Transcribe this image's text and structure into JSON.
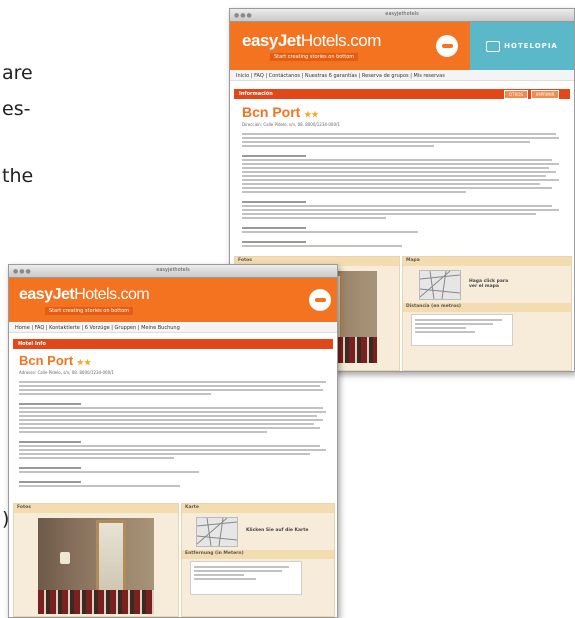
{
  "background_text": {
    "line1": "are",
    "line2": "es-",
    "line3": "the",
    "line4": ")"
  },
  "win_es": {
    "titlebar": "easyjethotels",
    "logo_bold": "easyJet",
    "logo_thin": "Hotels.com",
    "tagline": "Start creating stories on bottom",
    "partner": "HOTELOPIA",
    "nav": "Inicio | FAQ | Contáctanos | Nuestras 6 garantías | Reserva de grupos | Mis reservas",
    "section": "Información",
    "btn1": "OTROS",
    "btn2": "IMPRIMIR",
    "hotel_name": "Bcn Port",
    "stars": "★★",
    "address": "Dirección: Calle Pidelo, s/n, 08. 8000/1234-000/1",
    "photos_label": "Fotos",
    "map_label": "Mapa",
    "map_caption": "Haga click para ver el mapa",
    "distance_label": "Distancia (en metros)"
  },
  "win_de": {
    "titlebar": "easyjethotels",
    "logo_bold": "easyJet",
    "logo_thin": "Hotels.com",
    "tagline": "Start creating stories on bottom",
    "nav": "Home | FAQ | Kontaktierte | 6 Vorzüge | Gruppen | Meine Buchung",
    "section": "Hotel Info",
    "hotel_name": "Bcn Port",
    "stars": "★★",
    "address": "Adresse: Calle Pidelo, s/n, 08. 8000/1234-000/1",
    "photos_label": "Fotos",
    "map_label": "Karte",
    "map_caption": "Klicken Sie auf die Karte",
    "distance_label": "Entfernung (in Metern)"
  },
  "colors": {
    "brand": "#f37321",
    "section": "#e2471a",
    "partner": "#5bb8c9"
  }
}
